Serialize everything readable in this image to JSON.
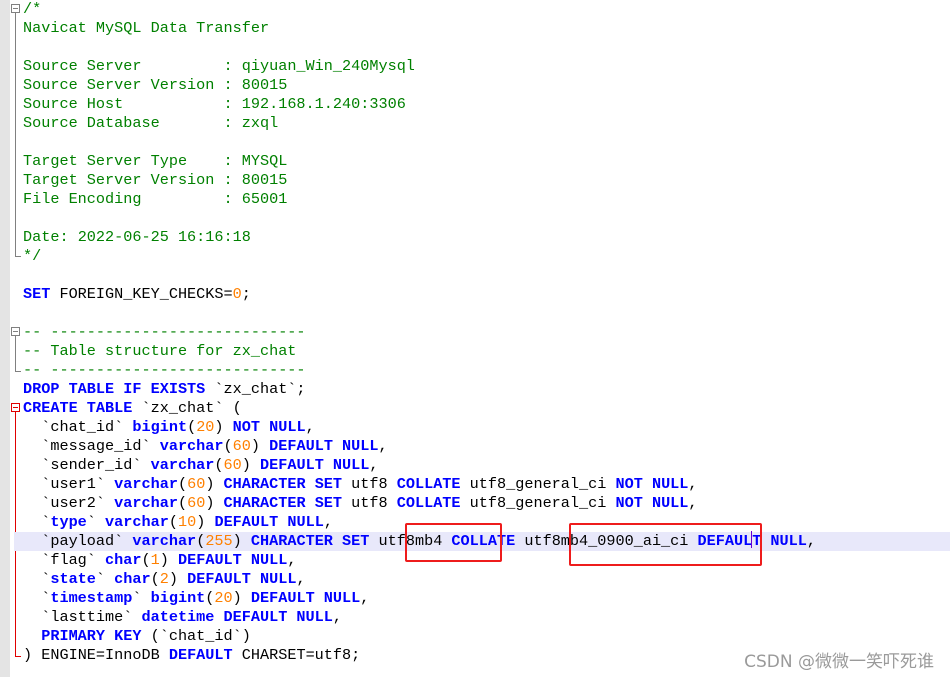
{
  "header_comment": {
    "open": "/*",
    "title": "Navicat MySQL Data Transfer",
    "fields": [
      {
        "key": "Source Server         ",
        "value": "qiyuan_Win_240Mysql"
      },
      {
        "key": "Source Server Version ",
        "value": "80015"
      },
      {
        "key": "Source Host           ",
        "value": "192.168.1.240:3306"
      },
      {
        "key": "Source Database       ",
        "value": "zxql"
      },
      {
        "key": "Target Server Type    ",
        "value": "MYSQL"
      },
      {
        "key": "Target Server Version ",
        "value": "80015"
      },
      {
        "key": "File Encoding         ",
        "value": "65001"
      }
    ],
    "date_label": "Date: ",
    "date_value": "2022-06-25 16:16:18",
    "close": "*/"
  },
  "set_stmt": {
    "keyword": "SET",
    "name": " FOREIGN_KEY_CHECKS=",
    "value": "0",
    "end": ";"
  },
  "section_comment": {
    "rule": "-- ----------------------------",
    "text": "-- Table structure for zx_chat"
  },
  "drop_stmt": {
    "kw": "DROP TABLE IF EXISTS",
    "rest": " `zx_chat`;"
  },
  "create_stmt": {
    "kw": "CREATE TABLE",
    "rest": " `zx_chat` ("
  },
  "columns": [
    {
      "name": "  `chat_id` ",
      "type": "bigint",
      "len": "20",
      "rest_kw": " NOT NULL",
      "tail": ","
    },
    {
      "name": "  `message_id` ",
      "type": "varchar",
      "len": "60",
      "rest_kw": " DEFAULT NULL",
      "tail": ","
    },
    {
      "name": "  `sender_id` ",
      "type": "varchar",
      "len": "60",
      "rest_kw": " DEFAULT NULL",
      "tail": ","
    },
    {
      "name": "  `user1` ",
      "type": "varchar",
      "len": "60",
      "charset_kw": " CHARACTER SET",
      "charset": " utf8 ",
      "collate_kw": "COLLATE",
      "collate": " utf8_general_ci ",
      "rest_kw": "NOT NULL",
      "tail": ","
    },
    {
      "name": "  `user2` ",
      "type": "varchar",
      "len": "60",
      "charset_kw": " CHARACTER SET",
      "charset": " utf8 ",
      "collate_kw": "COLLATE",
      "collate": " utf8_general_ci ",
      "rest_kw": "NOT NULL",
      "tail": ","
    },
    {
      "bq1": "  `",
      "name_kw": "type",
      "bq2": "` ",
      "type": "varchar",
      "len": "10",
      "rest_kw": " DEFAULT NULL",
      "tail": ","
    },
    {
      "name": "  `payload` ",
      "type": "varchar",
      "len": "255",
      "charset_kw": " CHARACTER SET",
      "charset": " utf8mb4 ",
      "collate_kw": "COLLATE",
      "collate": " utf8mb4_0900_ai_ci ",
      "rest_kw": "DEFAULT NULL",
      "tail": ","
    },
    {
      "name": "  `flag` ",
      "type": "char",
      "len": "1",
      "rest_kw": " DEFAULT NULL",
      "tail": ","
    },
    {
      "bq1": "  `",
      "name_kw": "state",
      "bq2": "` ",
      "type": "char",
      "len": "2",
      "rest_kw": " DEFAULT NULL",
      "tail": ","
    },
    {
      "bq1": "  `",
      "name_kw": "timestamp",
      "bq2": "` ",
      "type": "bigint",
      "len": "20",
      "rest_kw": " DEFAULT NULL",
      "tail": ","
    },
    {
      "name": "  `lasttime` ",
      "type": "datetime",
      "rest_kw": " DEFAULT NULL",
      "tail": ","
    }
  ],
  "primary_key": {
    "kw": "  PRIMARY KEY",
    "rest": " (`chat_id`)"
  },
  "table_end": {
    "paren": ") ",
    "engine": "ENGINE=InnoDB ",
    "kw": "DEFAULT",
    "charset": " CHARSET=utf8;"
  },
  "watermark": "CSDN @微微一笑吓死谁",
  "colors": {
    "comment": "#008000",
    "keyword": "#0000ff",
    "number": "#ff8000",
    "highlight_box": "#ee1c1c",
    "current_line": "#e8e8fa"
  }
}
